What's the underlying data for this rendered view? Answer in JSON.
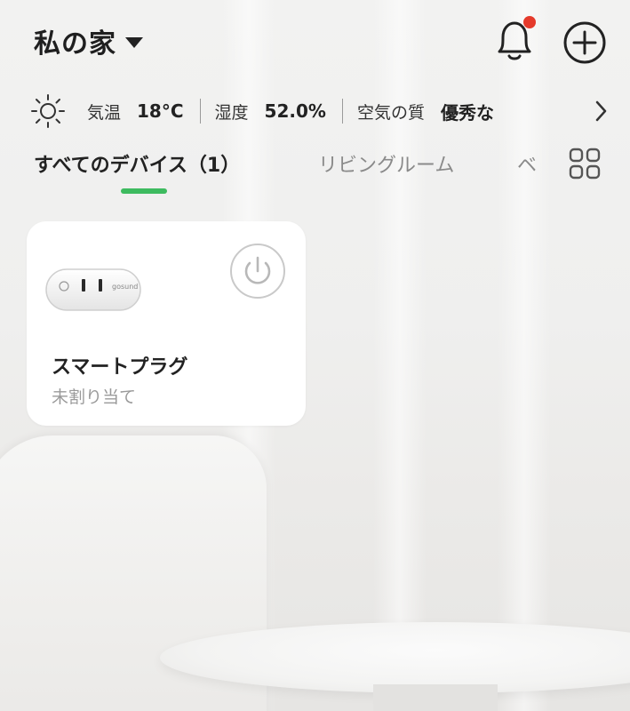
{
  "header": {
    "home_title": "私の家",
    "icons": {
      "dropdown": "caret-down-icon",
      "notifications": "bell-icon",
      "add": "plus-circle-icon"
    },
    "notification_dot_color": "#e53a2b"
  },
  "weather": {
    "icon": "sun-icon",
    "temperature_label": "気温",
    "temperature_value": "18°C",
    "humidity_label": "湿度",
    "humidity_value": "52.0%",
    "air_quality_label": "空気の質",
    "air_quality_value": "優秀な"
  },
  "tabs": {
    "items": [
      {
        "label": "すべてのデバイス（1）",
        "active": true
      },
      {
        "label": "リビングルーム",
        "active": false
      },
      {
        "label": "ベ",
        "active": false
      }
    ],
    "indicator_color": "#3dbb5f",
    "grid_icon": "grid-view-icon"
  },
  "devices": [
    {
      "name": "スマートプラグ",
      "room": "未割り当て",
      "image": "smart-plug-image",
      "brand_text": "gosund",
      "power_icon": "power-icon"
    }
  ]
}
